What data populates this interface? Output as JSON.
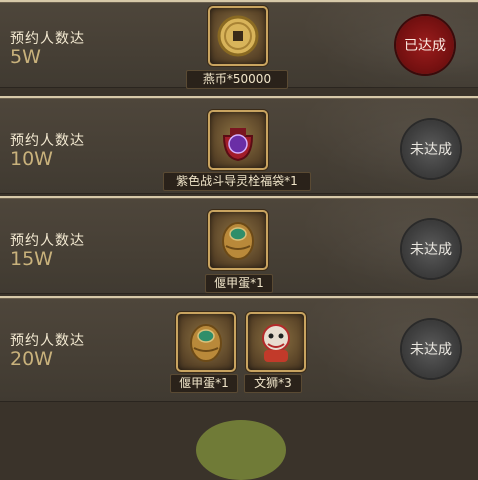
{
  "rows": [
    {
      "label": "预约人数达",
      "amount": "5W",
      "rewards": [
        {
          "icon": "coin-icon",
          "name": "燕币*50000"
        }
      ],
      "status": "已达成",
      "achieved": true
    },
    {
      "label": "预约人数达",
      "amount": "10W",
      "rewards": [
        {
          "icon": "lucky-bag-icon",
          "name": "紫色战斗导灵栓福袋*1"
        }
      ],
      "status": "未达成",
      "achieved": false
    },
    {
      "label": "预约人数达",
      "amount": "15W",
      "rewards": [
        {
          "icon": "beetle-egg-icon",
          "name": "偃甲蛋*1"
        }
      ],
      "status": "未达成",
      "achieved": false
    },
    {
      "label": "预约人数达",
      "amount": "20W",
      "rewards": [
        {
          "icon": "beetle-egg-icon",
          "name": "偃甲蛋*1"
        },
        {
          "icon": "lion-dance-icon",
          "name": "文狮*3"
        }
      ],
      "status": "未达成",
      "achieved": false
    }
  ],
  "colors": {
    "achieved_stamp": "#8b1717",
    "pending_stamp": "#4a4a4a",
    "amount_text": "#c9b27c"
  }
}
